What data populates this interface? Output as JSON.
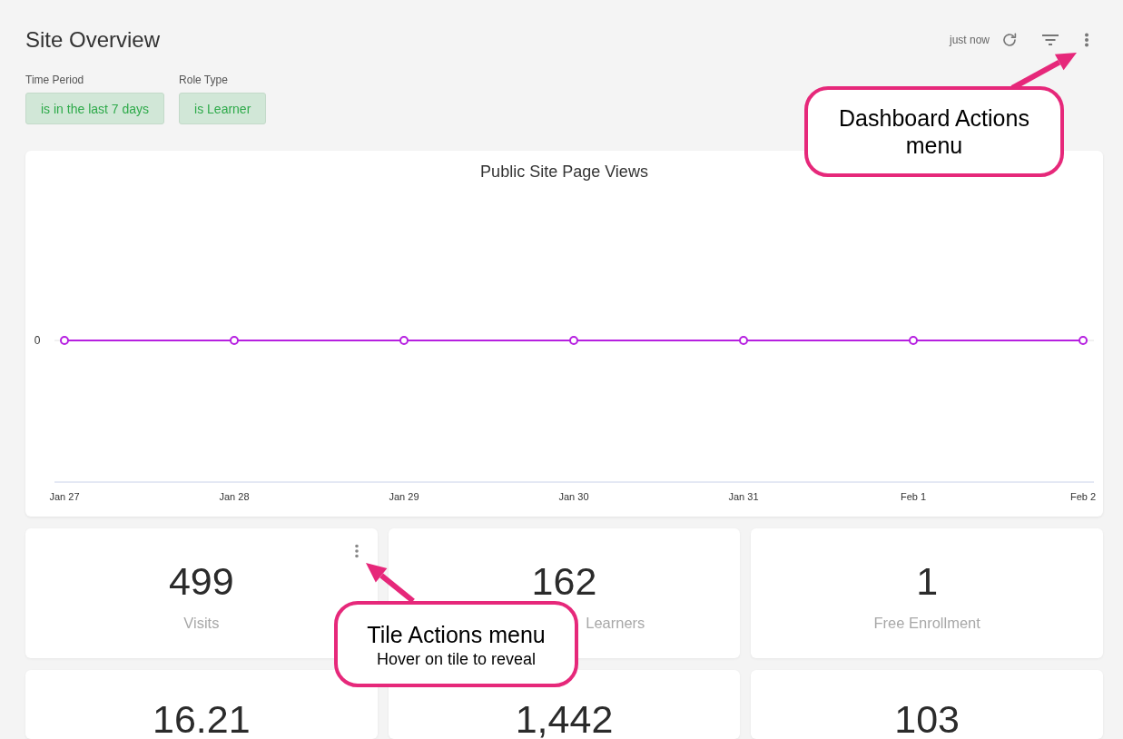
{
  "header": {
    "title": "Site Overview",
    "last_updated": "just now"
  },
  "filters": [
    {
      "label": "Time Period",
      "value": "is in the last 7 days"
    },
    {
      "label": "Role Type",
      "value": "is Learner"
    }
  ],
  "chart_tile": {
    "title": "Public Site Page Views",
    "y_axis_label": "0",
    "x_axis_labels": [
      "Jan 27",
      "Jan 28",
      "Jan 29",
      "Jan 30",
      "Jan 31",
      "Feb 1",
      "Feb 2"
    ]
  },
  "tiles": [
    {
      "value": "499",
      "label": "Visits",
      "actions_visible": true
    },
    {
      "value": "162",
      "label": "Learners",
      "actions_visible": false
    },
    {
      "value": "1",
      "label": "Free Enrollment",
      "actions_visible": false
    },
    {
      "value": "16.21",
      "actions_visible": false
    },
    {
      "value": "1,442",
      "actions_visible": false
    },
    {
      "value": "103",
      "actions_visible": false
    }
  ],
  "annotations": [
    {
      "kind": "dashboard",
      "title": "Dashboard Actions menu"
    },
    {
      "kind": "tile",
      "title": "Tile Actions menu",
      "subtitle": "Hover on tile to reveal"
    }
  ]
}
